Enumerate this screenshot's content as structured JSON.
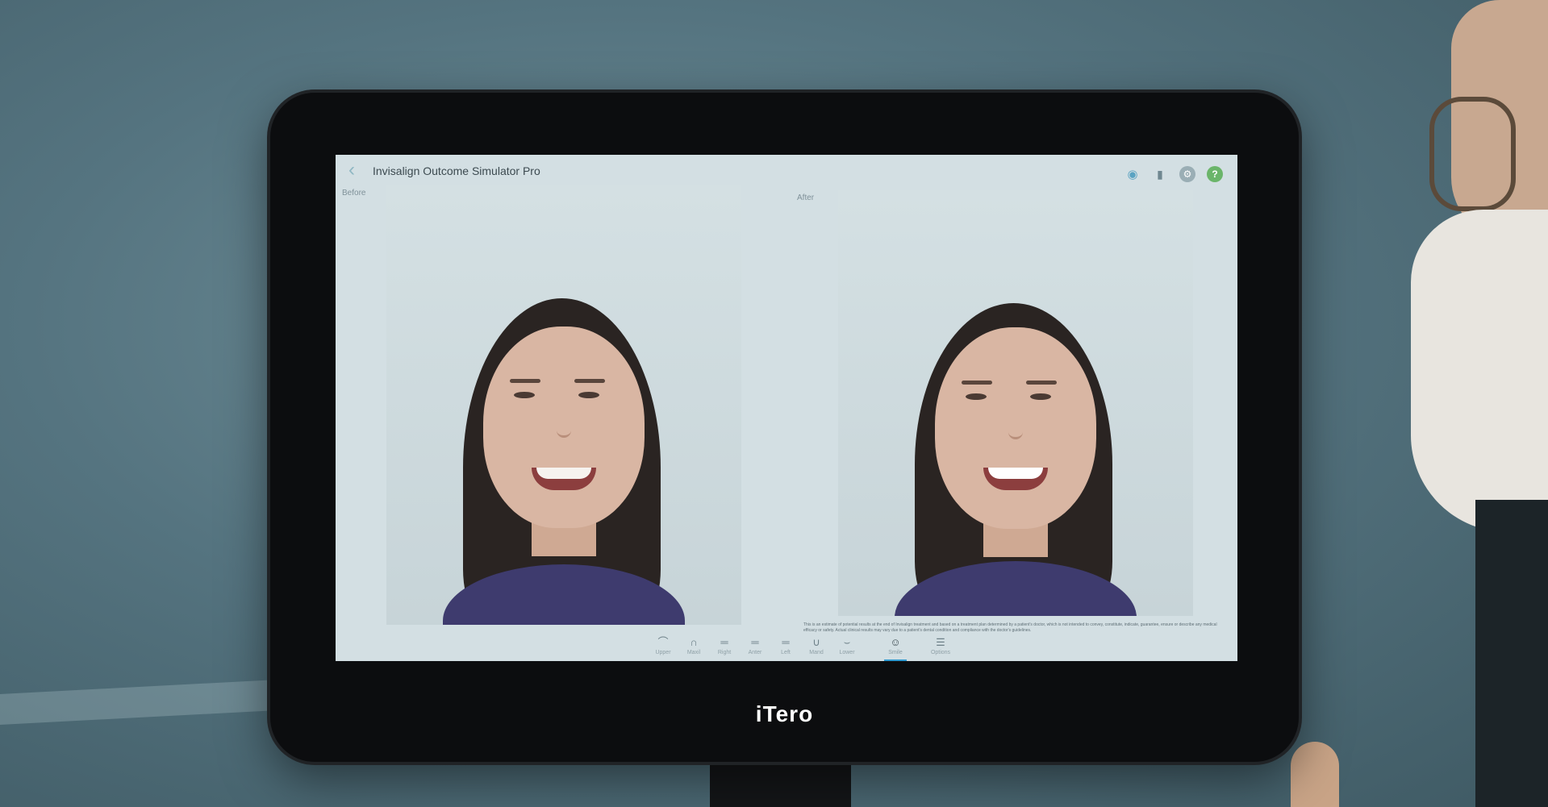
{
  "app": {
    "title": "Invisalign Outcome Simulator Pro"
  },
  "panes": {
    "before_label": "Before",
    "after_label": "After"
  },
  "disclaimer": "This is an estimate of potential results at the end of Invisalign treatment and based on a treatment plan determined by a patient's doctor, which is not intended to convey, constitute, indicate, guarantee, ensure or describe any medical efficacy or safety. Actual clinical results may vary due to a patient's dental condition and compliance with the doctor's guidelines.",
  "toolbar": {
    "items": [
      {
        "id": "upper",
        "label": "Upper",
        "glyph": "⌒"
      },
      {
        "id": "maxil",
        "label": "Maxil",
        "glyph": "∩"
      },
      {
        "id": "right",
        "label": "Right",
        "glyph": "═"
      },
      {
        "id": "anter",
        "label": "Anter",
        "glyph": "═"
      },
      {
        "id": "left",
        "label": "Left",
        "glyph": "═"
      },
      {
        "id": "mand",
        "label": "Mand",
        "glyph": "∪"
      },
      {
        "id": "lower",
        "label": "Lower",
        "glyph": "⌣"
      },
      {
        "id": "smile",
        "label": "Smile",
        "glyph": "☺"
      },
      {
        "id": "options",
        "label": "Options",
        "glyph": "☰"
      }
    ],
    "active": "smile"
  },
  "device": {
    "brand": "iTero"
  },
  "icons": {
    "back": "chevron-left-icon",
    "camera": "camera-icon",
    "battery": "battery-icon",
    "settings": "gear-icon",
    "help": "help-icon"
  },
  "colors": {
    "accent": "#2f9ad0",
    "help": "#6bb56a"
  }
}
